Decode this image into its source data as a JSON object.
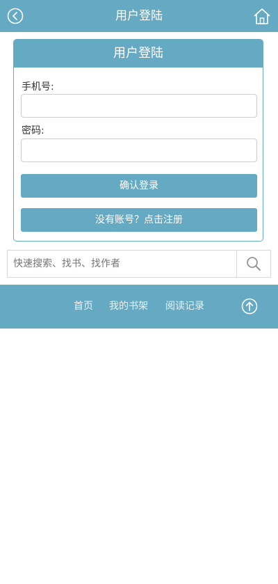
{
  "header": {
    "title": "用户登陆",
    "back_icon": "back-circle-icon",
    "home_icon": "home-icon"
  },
  "login": {
    "card_title": "用户登陆",
    "phone_label": "手机号:",
    "phone_value": "",
    "password_label": "密码:",
    "password_value": "",
    "submit_label": "确认登录",
    "register_label": "没有账号？点击注册"
  },
  "search": {
    "placeholder": "快速搜索、找书、找作者",
    "icon": "search-icon"
  },
  "footer": {
    "nav": [
      "首页",
      "我的书架",
      "阅读记录"
    ],
    "top_icon": "arrow-up-circle-icon"
  },
  "colors": {
    "accent": "#65a9c2",
    "border": "#c9ced3"
  }
}
